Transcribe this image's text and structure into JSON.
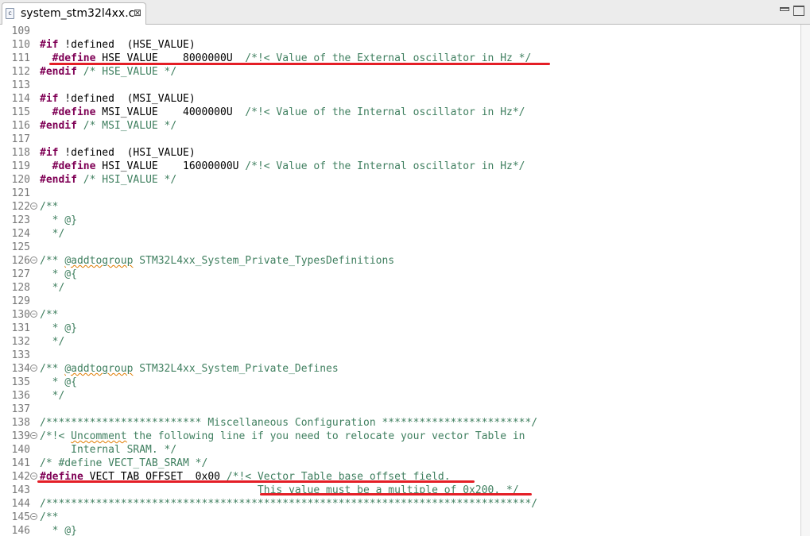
{
  "tab": {
    "title": "system_stm32l4xx.c",
    "close": "⊠",
    "icon": "c-file-icon"
  },
  "lines": [
    {
      "n": "109",
      "fold": false,
      "segs": []
    },
    {
      "n": "110",
      "fold": false,
      "segs": [
        {
          "t": "#if",
          "c": "kw"
        },
        {
          "t": " !defined  (HSE_VALUE)",
          "c": ""
        }
      ]
    },
    {
      "n": "111",
      "fold": false,
      "segs": [
        {
          "t": "  ",
          "c": ""
        },
        {
          "t": "#define",
          "c": "kw"
        },
        {
          "t": " HSE_VALUE    8000000U  ",
          "c": ""
        },
        {
          "t": "/*!< Value of the External oscillator in Hz */",
          "c": "cm"
        }
      ]
    },
    {
      "n": "112",
      "fold": false,
      "segs": [
        {
          "t": "#endif",
          "c": "kw"
        },
        {
          "t": " ",
          "c": ""
        },
        {
          "t": "/* HSE_VALUE */",
          "c": "cm"
        }
      ]
    },
    {
      "n": "113",
      "fold": false,
      "segs": []
    },
    {
      "n": "114",
      "fold": false,
      "segs": [
        {
          "t": "#if",
          "c": "kw"
        },
        {
          "t": " !defined  (MSI_VALUE)",
          "c": ""
        }
      ]
    },
    {
      "n": "115",
      "fold": false,
      "segs": [
        {
          "t": "  ",
          "c": ""
        },
        {
          "t": "#define",
          "c": "kw"
        },
        {
          "t": " MSI_VALUE    4000000U  ",
          "c": ""
        },
        {
          "t": "/*!< Value of the Internal oscillator in Hz*/",
          "c": "cm"
        }
      ]
    },
    {
      "n": "116",
      "fold": false,
      "segs": [
        {
          "t": "#endif",
          "c": "kw"
        },
        {
          "t": " ",
          "c": ""
        },
        {
          "t": "/* MSI_VALUE */",
          "c": "cm"
        }
      ]
    },
    {
      "n": "117",
      "fold": false,
      "segs": []
    },
    {
      "n": "118",
      "fold": false,
      "segs": [
        {
          "t": "#if",
          "c": "kw"
        },
        {
          "t": " !defined  (HSI_VALUE)",
          "c": ""
        }
      ]
    },
    {
      "n": "119",
      "fold": false,
      "segs": [
        {
          "t": "  ",
          "c": ""
        },
        {
          "t": "#define",
          "c": "kw"
        },
        {
          "t": " HSI_VALUE    16000000U ",
          "c": ""
        },
        {
          "t": "/*!< Value of the Internal oscillator in Hz*/",
          "c": "cm"
        }
      ]
    },
    {
      "n": "120",
      "fold": false,
      "segs": [
        {
          "t": "#endif",
          "c": "kw"
        },
        {
          "t": " ",
          "c": ""
        },
        {
          "t": "/* HSI_VALUE */",
          "c": "cm"
        }
      ]
    },
    {
      "n": "121",
      "fold": false,
      "segs": []
    },
    {
      "n": "122",
      "fold": true,
      "segs": [
        {
          "t": "/**",
          "c": "cm"
        }
      ]
    },
    {
      "n": "123",
      "fold": false,
      "segs": [
        {
          "t": "  * @}",
          "c": "cm"
        }
      ]
    },
    {
      "n": "124",
      "fold": false,
      "segs": [
        {
          "t": "  */",
          "c": "cm"
        }
      ]
    },
    {
      "n": "125",
      "fold": false,
      "segs": []
    },
    {
      "n": "126",
      "fold": true,
      "segs": [
        {
          "t": "/** ",
          "c": "cm"
        },
        {
          "t": "@addtogroup",
          "c": "cm sq"
        },
        {
          "t": " STM32L4xx_System_Private_TypesDefinitions",
          "c": "cm"
        }
      ]
    },
    {
      "n": "127",
      "fold": false,
      "segs": [
        {
          "t": "  * @{",
          "c": "cm"
        }
      ]
    },
    {
      "n": "128",
      "fold": false,
      "segs": [
        {
          "t": "  */",
          "c": "cm"
        }
      ]
    },
    {
      "n": "129",
      "fold": false,
      "segs": []
    },
    {
      "n": "130",
      "fold": true,
      "segs": [
        {
          "t": "/**",
          "c": "cm"
        }
      ]
    },
    {
      "n": "131",
      "fold": false,
      "segs": [
        {
          "t": "  * @}",
          "c": "cm"
        }
      ]
    },
    {
      "n": "132",
      "fold": false,
      "segs": [
        {
          "t": "  */",
          "c": "cm"
        }
      ]
    },
    {
      "n": "133",
      "fold": false,
      "segs": []
    },
    {
      "n": "134",
      "fold": true,
      "segs": [
        {
          "t": "/** ",
          "c": "cm"
        },
        {
          "t": "@addtogroup",
          "c": "cm sq"
        },
        {
          "t": " STM32L4xx_System_Private_Defines",
          "c": "cm"
        }
      ]
    },
    {
      "n": "135",
      "fold": false,
      "segs": [
        {
          "t": "  * @{",
          "c": "cm"
        }
      ]
    },
    {
      "n": "136",
      "fold": false,
      "segs": [
        {
          "t": "  */",
          "c": "cm"
        }
      ]
    },
    {
      "n": "137",
      "fold": false,
      "segs": []
    },
    {
      "n": "138",
      "fold": false,
      "segs": [
        {
          "t": "/************************* Miscellaneous Configuration ************************/",
          "c": "cm"
        }
      ]
    },
    {
      "n": "139",
      "fold": true,
      "segs": [
        {
          "t": "/*!< ",
          "c": "cm"
        },
        {
          "t": "Uncomment",
          "c": "cm sq"
        },
        {
          "t": " the following line if you need to relocate your vector Table in",
          "c": "cm"
        }
      ]
    },
    {
      "n": "140",
      "fold": false,
      "segs": [
        {
          "t": "     Internal SRAM. */",
          "c": "cm"
        }
      ]
    },
    {
      "n": "141",
      "fold": false,
      "segs": [
        {
          "t": "/* #define VECT_TAB_SRAM */",
          "c": "cm"
        }
      ]
    },
    {
      "n": "142",
      "fold": true,
      "segs": [
        {
          "t": "#define",
          "c": "kw"
        },
        {
          "t": " VECT_TAB_OFFSET  0x00 ",
          "c": ""
        },
        {
          "t": "/*!< Vector Table base offset field.",
          "c": "cm"
        }
      ]
    },
    {
      "n": "143",
      "fold": false,
      "segs": [
        {
          "t": "                                   This value must be a multiple of 0x200. */",
          "c": "cm"
        }
      ]
    },
    {
      "n": "144",
      "fold": false,
      "segs": [
        {
          "t": "/******************************************************************************/",
          "c": "cm"
        }
      ]
    },
    {
      "n": "145",
      "fold": true,
      "segs": [
        {
          "t": "/**",
          "c": "cm"
        }
      ]
    },
    {
      "n": "146",
      "fold": false,
      "segs": [
        {
          "t": "  * @}",
          "c": "cm"
        }
      ]
    }
  ],
  "annotation_color": "#e41e26"
}
